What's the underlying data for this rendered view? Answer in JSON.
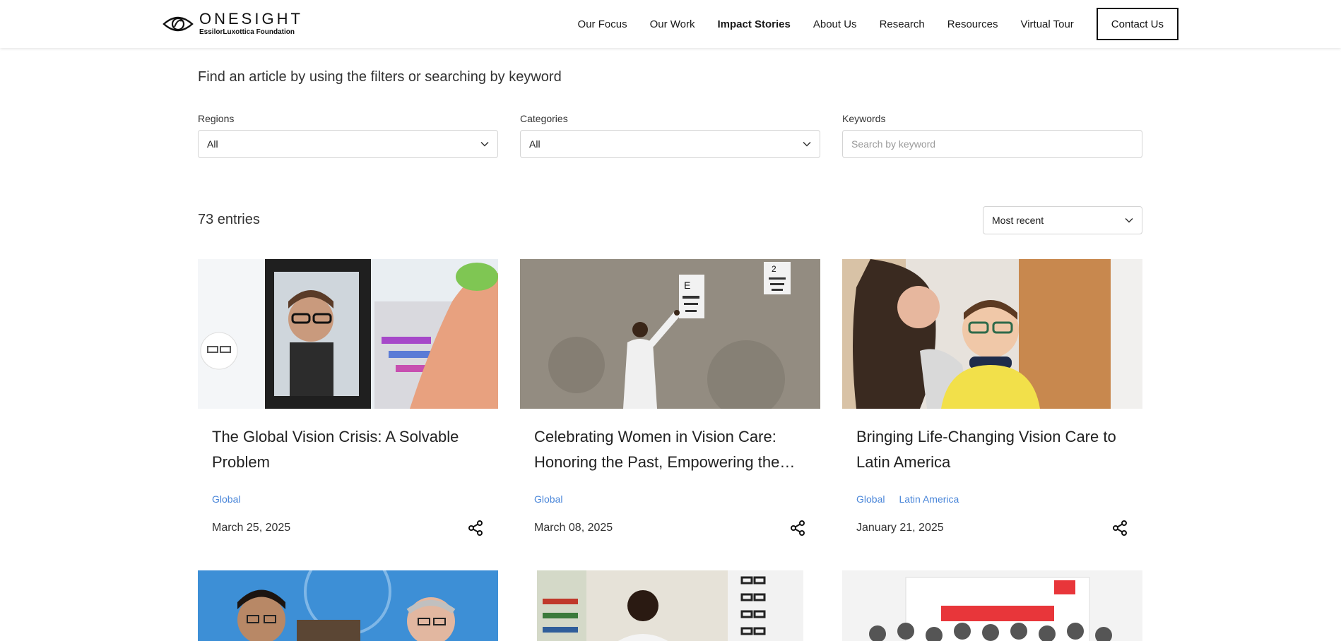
{
  "header": {
    "logo_main": "ONESIGHT",
    "logo_sub": "EssilorLuxottica Foundation",
    "nav": [
      "Our Focus",
      "Our Work",
      "Impact Stories",
      "About Us",
      "Research",
      "Resources",
      "Virtual Tour"
    ],
    "contact_label": "Contact Us"
  },
  "intro": "Find an article by using the filters or searching by keyword",
  "filters": {
    "regions_label": "Regions",
    "regions_value": "All",
    "categories_label": "Categories",
    "categories_value": "All",
    "keywords_label": "Keywords",
    "keywords_placeholder": "Search by keyword"
  },
  "entries": "73 entries",
  "sort_value": "Most recent",
  "cards": [
    {
      "title": "The Global Vision Crisis: A Solvable Problem",
      "tags": [
        "Global"
      ],
      "date": "March 25, 2025"
    },
    {
      "title": "Celebrating Women in Vision Care: Honoring the Past, Empowering the Future",
      "tags": [
        "Global"
      ],
      "date": "March 08, 2025"
    },
    {
      "title": "Bringing Life-Changing Vision Care to Latin America",
      "tags": [
        "Global",
        "Latin America"
      ],
      "date": "January 21, 2025"
    }
  ],
  "colors": {
    "tag": "#4a86d9",
    "accent": "#111111"
  },
  "icons": {
    "share": "share-icon",
    "chevron": "chevron-down-icon",
    "logo": "eye-logo-icon"
  }
}
